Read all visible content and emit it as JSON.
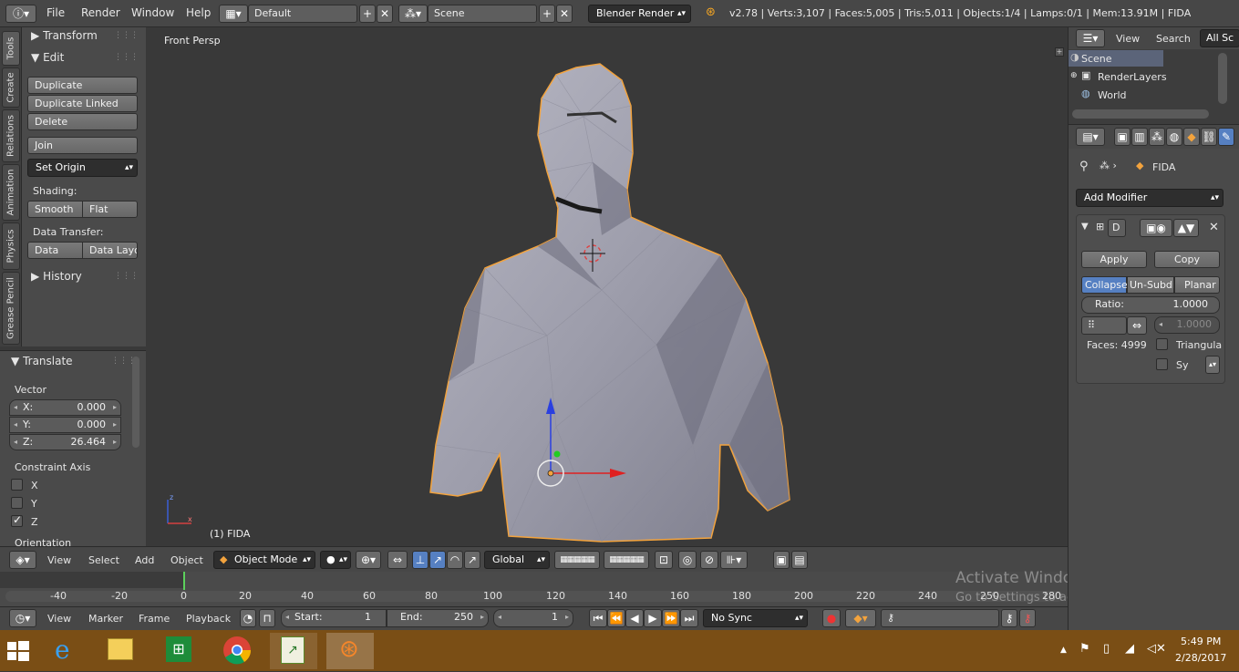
{
  "topbar": {
    "menus": [
      "File",
      "Render",
      "Window",
      "Help"
    ],
    "layout_name": "Default",
    "scene_name": "Scene",
    "render_engine": "Blender Render",
    "stats": "v2.78 | Verts:3,107 | Faces:5,005 | Tris:5,011 | Objects:1/4 | Lamps:0/1 | Mem:13.91M | FIDA"
  },
  "tool_tabs": [
    "Tools",
    "Create",
    "Relations",
    "Animation",
    "Physics",
    "Grease Pencil"
  ],
  "tools": {
    "transform_header": "Transform",
    "edit_header": "Edit",
    "duplicate": "Duplicate",
    "duplicate_linked": "Duplicate Linked",
    "delete": "Delete",
    "join": "Join",
    "set_origin": "Set Origin",
    "shading_label": "Shading:",
    "smooth": "Smooth",
    "flat": "Flat",
    "data_transfer_label": "Data Transfer:",
    "data": "Data",
    "data_layout": "Data Layo",
    "history_header": "History"
  },
  "operator": {
    "header": "Translate",
    "vector_label": "Vector",
    "x_label": "X:",
    "x_value": "0.000",
    "y_label": "Y:",
    "y_value": "0.000",
    "z_label": "Z:",
    "z_value": "26.464",
    "constraint_label": "Constraint Axis",
    "axis_x": "X",
    "axis_y": "Y",
    "axis_z": "Z",
    "orientation_label": "Orientation"
  },
  "viewport": {
    "view_name": "Front Persp",
    "object_label": "(1) FIDA",
    "axis_x": "x",
    "axis_z": "z"
  },
  "view3d_header": {
    "view": "View",
    "select": "Select",
    "add": "Add",
    "object": "Object",
    "mode": "Object Mode",
    "orientation": "Global"
  },
  "timeline": {
    "ticks": [
      "-40",
      "-20",
      "0",
      "20",
      "40",
      "60",
      "80",
      "100",
      "120",
      "140",
      "160",
      "180",
      "200",
      "220",
      "240",
      "250",
      "280"
    ],
    "view": "View",
    "marker": "Marker",
    "frame": "Frame",
    "playback": "Playback",
    "start_label": "Start:",
    "start_value": "1",
    "end_label": "End:",
    "end_value": "250",
    "current_frame": "1",
    "sync": "No Sync"
  },
  "watermark": {
    "line1": "Activate Windows",
    "line2": "Go to Settings to activate Windows."
  },
  "outliner": {
    "view": "View",
    "search": "Search",
    "filter": "All Sc",
    "items": [
      "Scene",
      "RenderLayers",
      "World"
    ]
  },
  "properties": {
    "object_name": "FIDA",
    "add_modifier": "Add Modifier",
    "apply": "Apply",
    "copy": "Copy",
    "tab_collapse": "Collapse",
    "tab_unsubdiv": "Un-Subdiv",
    "tab_planar": "Planar",
    "ratio_label": "Ratio:",
    "ratio_value": "1.0000",
    "symmetry_value": "1.0000",
    "faces_label": "Faces: 4999",
    "triangulate": "Triangula",
    "symmetry": "Sy",
    "modifier_d": "D"
  },
  "taskbar": {
    "time": "5:49 PM",
    "date": "2/28/2017"
  },
  "colors": {
    "accent": "#5680c2",
    "selection_outline": "#f3a33d",
    "taskbar": "#7a4e15"
  }
}
